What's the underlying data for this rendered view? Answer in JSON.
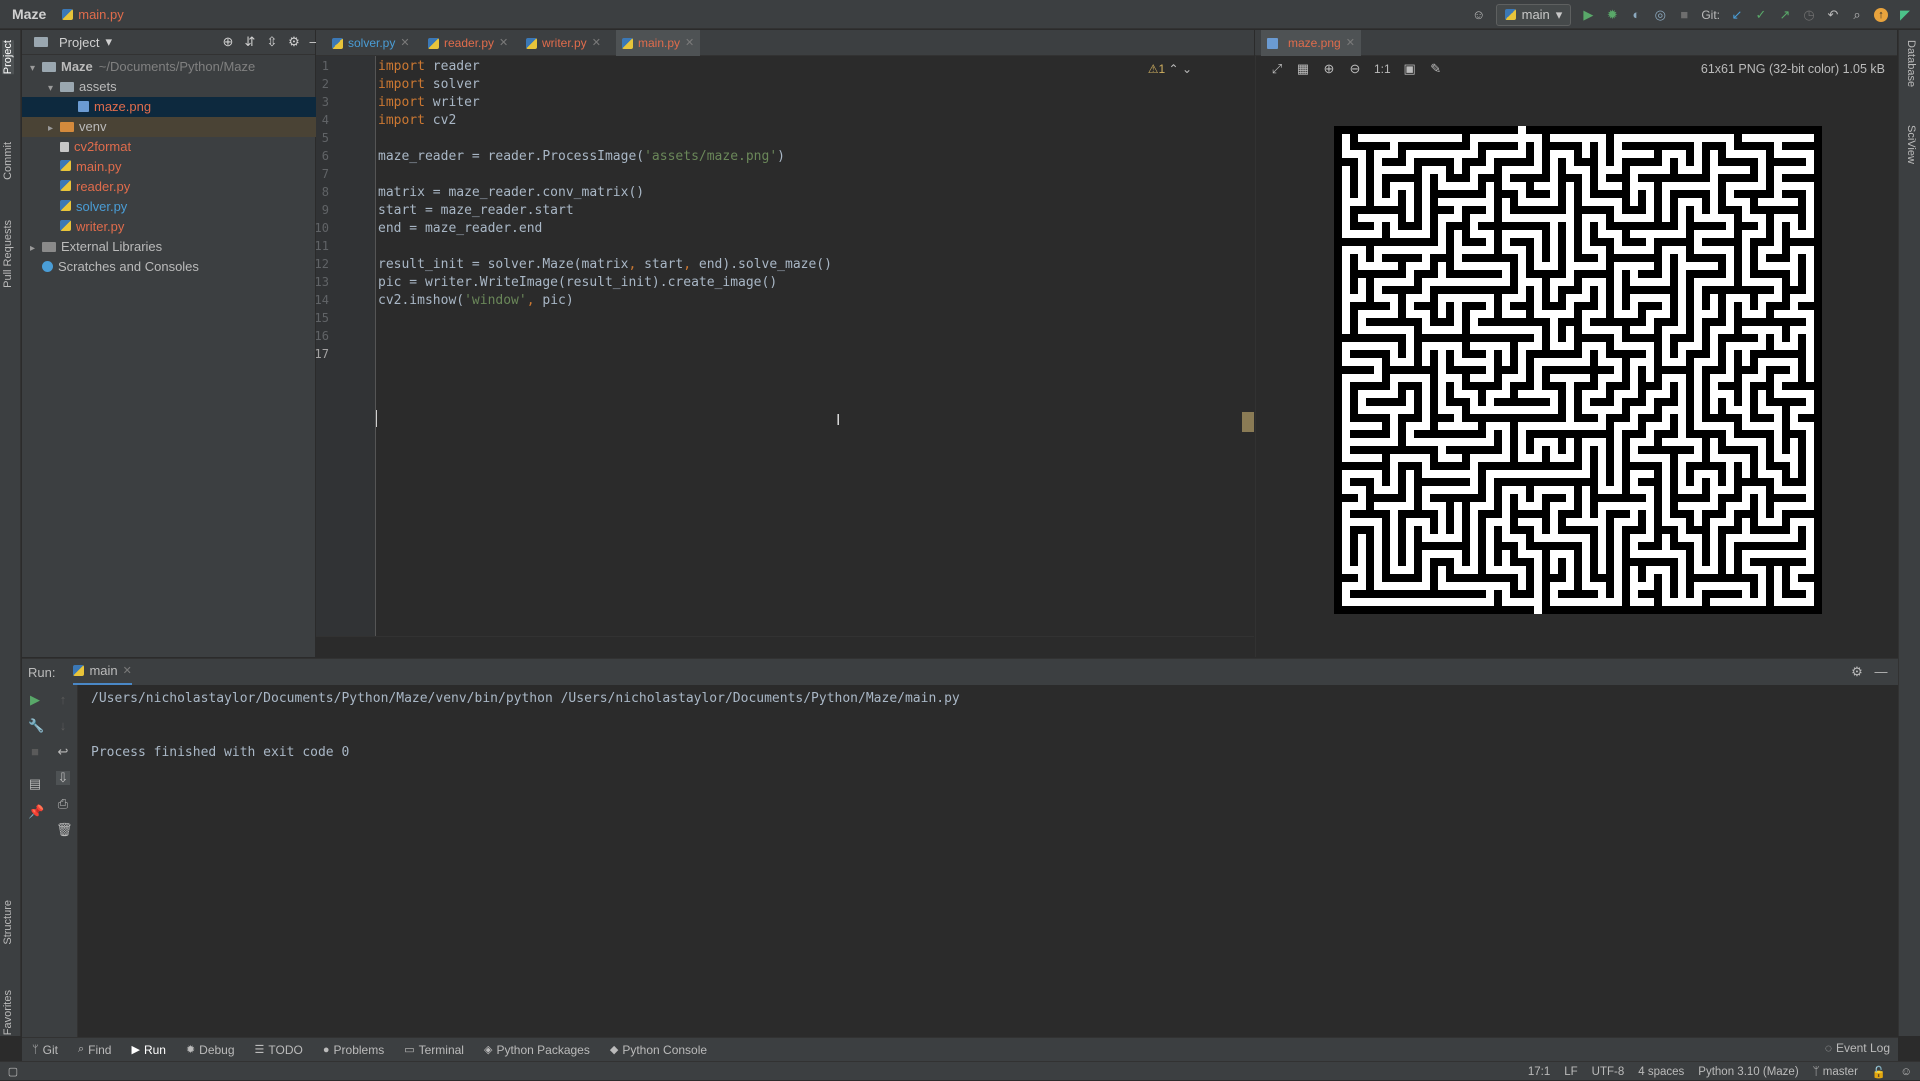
{
  "titlebar": {
    "project": "Maze",
    "file": "main.py",
    "run_config": "main",
    "git_label": "Git:"
  },
  "side_tools_left": [
    "Project",
    "Commit",
    "Pull Requests",
    "Structure",
    "Favorites"
  ],
  "side_tools_right": [
    "Database",
    "SciView"
  ],
  "project_panel": {
    "header": "Project",
    "tree": [
      {
        "label": "Maze",
        "sub": "~/Documents/Python/Maze",
        "depth": 0,
        "kind": "folder",
        "color": "#bbbbbb",
        "bold": true,
        "arrow": "▾"
      },
      {
        "label": "assets",
        "depth": 1,
        "kind": "folder",
        "color": "#bbbbbb",
        "arrow": "▾"
      },
      {
        "label": "maze.png",
        "depth": 2,
        "kind": "image",
        "color": "#e06c4c",
        "selected": true
      },
      {
        "label": "venv",
        "depth": 1,
        "kind": "folder-orange",
        "color": "#bbbbbb",
        "arrow": "▸",
        "vsel": true
      },
      {
        "label": "cv2format",
        "depth": 1,
        "kind": "file",
        "color": "#e06c4c"
      },
      {
        "label": "main.py",
        "depth": 1,
        "kind": "py",
        "color": "#e06c4c"
      },
      {
        "label": "reader.py",
        "depth": 1,
        "kind": "py",
        "color": "#e06c4c"
      },
      {
        "label": "solver.py",
        "depth": 1,
        "kind": "py",
        "color": "#4a9dd6"
      },
      {
        "label": "writer.py",
        "depth": 1,
        "kind": "py",
        "color": "#e06c4c"
      },
      {
        "label": "External Libraries",
        "depth": 0,
        "kind": "lib",
        "color": "#bbbbbb",
        "arrow": "▸"
      },
      {
        "label": "Scratches and Consoles",
        "depth": 0,
        "kind": "scratch",
        "color": "#bbbbbb"
      }
    ]
  },
  "editor_tabs": [
    {
      "label": "solver.py",
      "color": "#4a9dd6",
      "active": false
    },
    {
      "label": "reader.py",
      "color": "#e06c4c",
      "active": false
    },
    {
      "label": "writer.py",
      "color": "#e06c4c",
      "active": false
    },
    {
      "label": "main.py",
      "color": "#e06c4c",
      "active": true
    }
  ],
  "editor": {
    "inspection": "⚠1",
    "lines": [
      [
        [
          "kw",
          "import"
        ],
        [
          "id",
          " reader"
        ]
      ],
      [
        [
          "kw",
          "import"
        ],
        [
          "id",
          " solver"
        ]
      ],
      [
        [
          "kw",
          "import"
        ],
        [
          "id",
          " writer"
        ]
      ],
      [
        [
          "kw",
          "import"
        ],
        [
          "id",
          " cv2"
        ]
      ],
      [],
      [
        [
          "id",
          "maze_reader = reader.ProcessImage("
        ],
        [
          "str",
          "'assets/maze.png'"
        ],
        [
          "id",
          ")"
        ]
      ],
      [],
      [
        [
          "id",
          "matrix = maze_reader.conv_matrix()"
        ]
      ],
      [
        [
          "id",
          "start = maze_reader.start"
        ]
      ],
      [
        [
          "id",
          "end = maze_reader.end"
        ]
      ],
      [],
      [
        [
          "id",
          "result_init = solver.Maze(matrix"
        ],
        [
          "kw",
          ","
        ],
        [
          "id",
          " start"
        ],
        [
          "kw",
          ","
        ],
        [
          "id",
          " end).solve_maze()"
        ]
      ],
      [
        [
          "id",
          "pic = writer.WriteImage(result_init).create_image()"
        ]
      ],
      [
        [
          "id",
          "cv2.imshow("
        ],
        [
          "str",
          "'window'"
        ],
        [
          "kw",
          ","
        ],
        [
          "id",
          " pic)"
        ]
      ],
      [],
      [],
      []
    ]
  },
  "image_viewer": {
    "tab": "maze.png",
    "info": "61x61 PNG (32-bit color) 1.05 kB",
    "zoom_label": "1:1"
  },
  "run_panel": {
    "title": "Run:",
    "tab": "main",
    "output": [
      "/Users/nicholastaylor/Documents/Python/Maze/venv/bin/python /Users/nicholastaylor/Documents/Python/Maze/main.py",
      "",
      "",
      "Process finished with exit code 0"
    ]
  },
  "bottom_tools": [
    {
      "label": "Git",
      "icon": "git-branch-icon",
      "glyph": "ᛘ"
    },
    {
      "label": "Find",
      "icon": "search-icon",
      "glyph": "⌕"
    },
    {
      "label": "Run",
      "icon": "play-icon",
      "glyph": "▶",
      "active": true
    },
    {
      "label": "Debug",
      "icon": "bug-icon",
      "glyph": "✹"
    },
    {
      "label": "TODO",
      "icon": "list-icon",
      "glyph": "☰"
    },
    {
      "label": "Problems",
      "icon": "info-icon",
      "glyph": "●"
    },
    {
      "label": "Terminal",
      "icon": "terminal-icon",
      "glyph": "▭"
    },
    {
      "label": "Python Packages",
      "icon": "package-icon",
      "glyph": "◈"
    },
    {
      "label": "Python Console",
      "icon": "python-icon",
      "glyph": "◆"
    }
  ],
  "event_log": "Event Log",
  "status": {
    "position": "17:1",
    "line_sep": "LF",
    "encoding": "UTF-8",
    "indent": "4 spaces",
    "interpreter": "Python 3.10 (Maze)",
    "branch": "master"
  }
}
